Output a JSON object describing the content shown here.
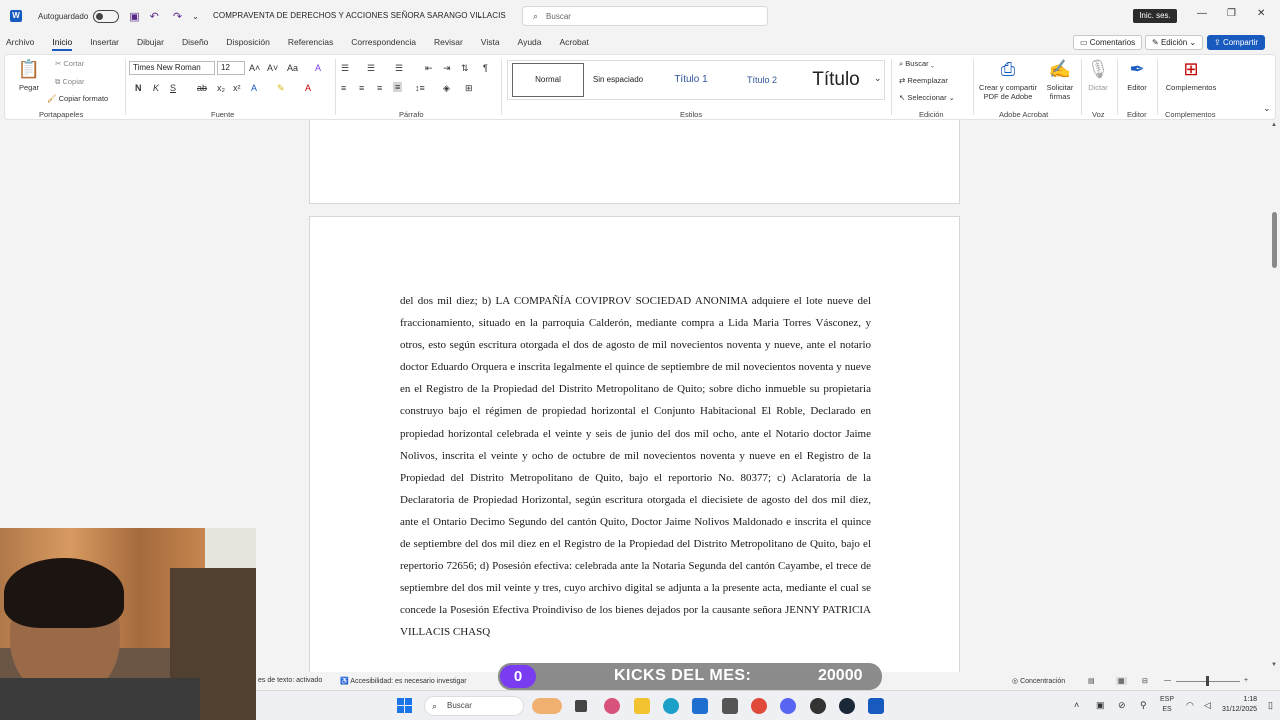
{
  "titlebar": {
    "autosave_label": "Autoguardado",
    "doc_title": "COMPRAVENTA DE DERECHOS Y ACCIONES SEÑORA SARANGO VILLACIS",
    "search_placeholder": "Buscar",
    "signin_label": "Inic. ses."
  },
  "tabs": [
    "Archivo",
    "Inicio",
    "Insertar",
    "Dibujar",
    "Diseño",
    "Disposición",
    "Referencias",
    "Correspondencia",
    "Revisar",
    "Vista",
    "Ayuda",
    "Acrobat"
  ],
  "active_tab": "Inicio",
  "tab_actions": {
    "comments": "Comentarios",
    "editing": "Edición",
    "share": "Compartir"
  },
  "ribbon": {
    "clipboard": {
      "paste": "Pegar",
      "cut": "Cortar",
      "copy": "Copiar",
      "format_painter": "Copiar formato",
      "label": "Portapapeles"
    },
    "font": {
      "family": "Times New Roman",
      "size": "12",
      "label": "Fuente"
    },
    "paragraph": {
      "label": "Párrafo"
    },
    "styles": {
      "items": [
        "Normal",
        "Sin espaciado",
        "Título 1",
        "Título 2",
        "Título"
      ],
      "label": "Estilos"
    },
    "editing": {
      "find": "Buscar",
      "replace": "Reemplazar",
      "select": "Seleccionar",
      "label": "Edición"
    },
    "adobe": {
      "create_share": "Crear y compartir PDF de Adobe",
      "request_signatures": "Solicitar firmas",
      "label": "Adobe Acrobat"
    },
    "voice": {
      "dictate": "Dictar",
      "label": "Voz"
    },
    "editor": {
      "button": "Editor",
      "label": "Editor"
    },
    "addins": {
      "button": "Complementos",
      "label": "Complementos"
    }
  },
  "document": {
    "paragraph": "del dos mil diez; b) LA COMPAÑÍA COVIPROV SOCIEDAD ANONIMA adquiere el lote nueve del fraccionamiento, situado en la parroquia Calderón, mediante compra a Lida Maria Torres Vásconez, y otros, esto según escritura otorgada el dos de agosto de mil novecientos noventa y nueve, ante el notario doctor Eduardo Orquera e inscrita legalmente el quince de septiembre de mil novecientos noventa y nueve en el Registro de la Propiedad del Distrito Metropolitano de Quito; sobre dicho inmueble su propietaria construyo bajo el régimen de propiedad horizontal el Conjunto Habitacional El Roble, Declarado en propiedad horizontal celebrada el veinte y seis de junio del dos mil ocho, ante el Notario doctor Jaime Nolivos, inscrita el veinte y ocho de octubre de mil novecientos noventa y nueve en el Registro de la Propiedad del Distrito Metropolitano de Quito, bajo el reportorio No. 80377; c) Aclaratoria de la Declaratoria de Propiedad Horizontal, según escritura otorgada el diecisiete de agosto del dos mil diez, ante el Ontario Decimo Segundo del cantón Quito, Doctor Jaime Nolivos Maldonado e inscrita el quince de septiembre del dos mil diez en el Registro de la Propiedad del Distrito Metropolitano de Quito, bajo el repertorio 72656; d) Posesión efectiva: celebrada ante la Notaria Segunda del cantón Cayambe, el trece de septiembre del dos mil veinte y tres, cuyo archivo digital se adjunta a la presente acta, mediante el cual se concede la Posesión Efectiva Proindiviso de los bienes dejados por la causante señora JENNY PATRICIA VILLACIS CHASQ"
  },
  "statusbar": {
    "predictions": "es de texto: activado",
    "accessibility": "Accesibilidad: es necesario investigar",
    "focus": "Concentración"
  },
  "taskbar": {
    "search": "Buscar",
    "lang_top": "ESP",
    "lang_bottom": "ES",
    "time": "1:18",
    "date": "31/12/2025"
  },
  "overlay": {
    "kicks_count": "0",
    "kicks_label": "KICKS DEL MES:",
    "kicks_goal": "20000"
  },
  "colors": {
    "accent": "#185abd",
    "kicks_badge": "#7a3cf0"
  }
}
